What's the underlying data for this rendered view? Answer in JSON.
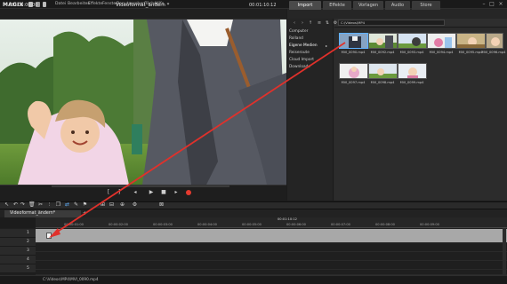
{
  "app": {
    "brand": "MAGIX",
    "menu": [
      "Datei",
      "Bearbeiten",
      "Effekte",
      "Fenster",
      "Benutzeroberflächen",
      "Hilfe"
    ]
  },
  "preview": {
    "timecode_left": "00:00:00:00",
    "title": "Videoformat_ändern *",
    "timecode_right": "00:01:10:12"
  },
  "panel": {
    "tabs": [
      "Import",
      "Effekte",
      "Vorlagen",
      "Audio",
      "Store"
    ],
    "tree": [
      "Computer",
      "Rolland",
      "Eigene Medien",
      "Reiseroute",
      "Cloud Import",
      "Downloads"
    ],
    "path": "C:\\Videos\\MP4",
    "thumbnails": [
      "MVI_0090.mp4",
      "MVI_0092.mp4",
      "MVI_0093.mp4",
      "MVI_0094.mp4",
      "MVI_0095.mp4",
      "MVI_0096.mp4",
      "MVI_0097.mp4",
      "MVI_0098.mp4",
      "MVI_0099.mp4"
    ],
    "selected_index": 0
  },
  "project": {
    "tab_label": "Videoformat_ändern*",
    "ruler_time": "00:01:10:12",
    "ruler_ticks": [
      "00:00:01:00",
      "00:00:02:00",
      "00:00:03:00",
      "00:00:04:00",
      "00:00:05:00",
      "00:00:06:00",
      "00:00:07:00",
      "00:00:08:00",
      "00:00:09:00"
    ],
    "tracks": [
      "1",
      "2",
      "3",
      "4",
      "5"
    ]
  },
  "status": {
    "path": "C:\\Videos\\MP4\\MVI_0090.mp4"
  },
  "colors": {
    "accent_blue": "#5fb1ff",
    "arrow_red": "#e0312b",
    "record_red": "#e53a2f"
  }
}
